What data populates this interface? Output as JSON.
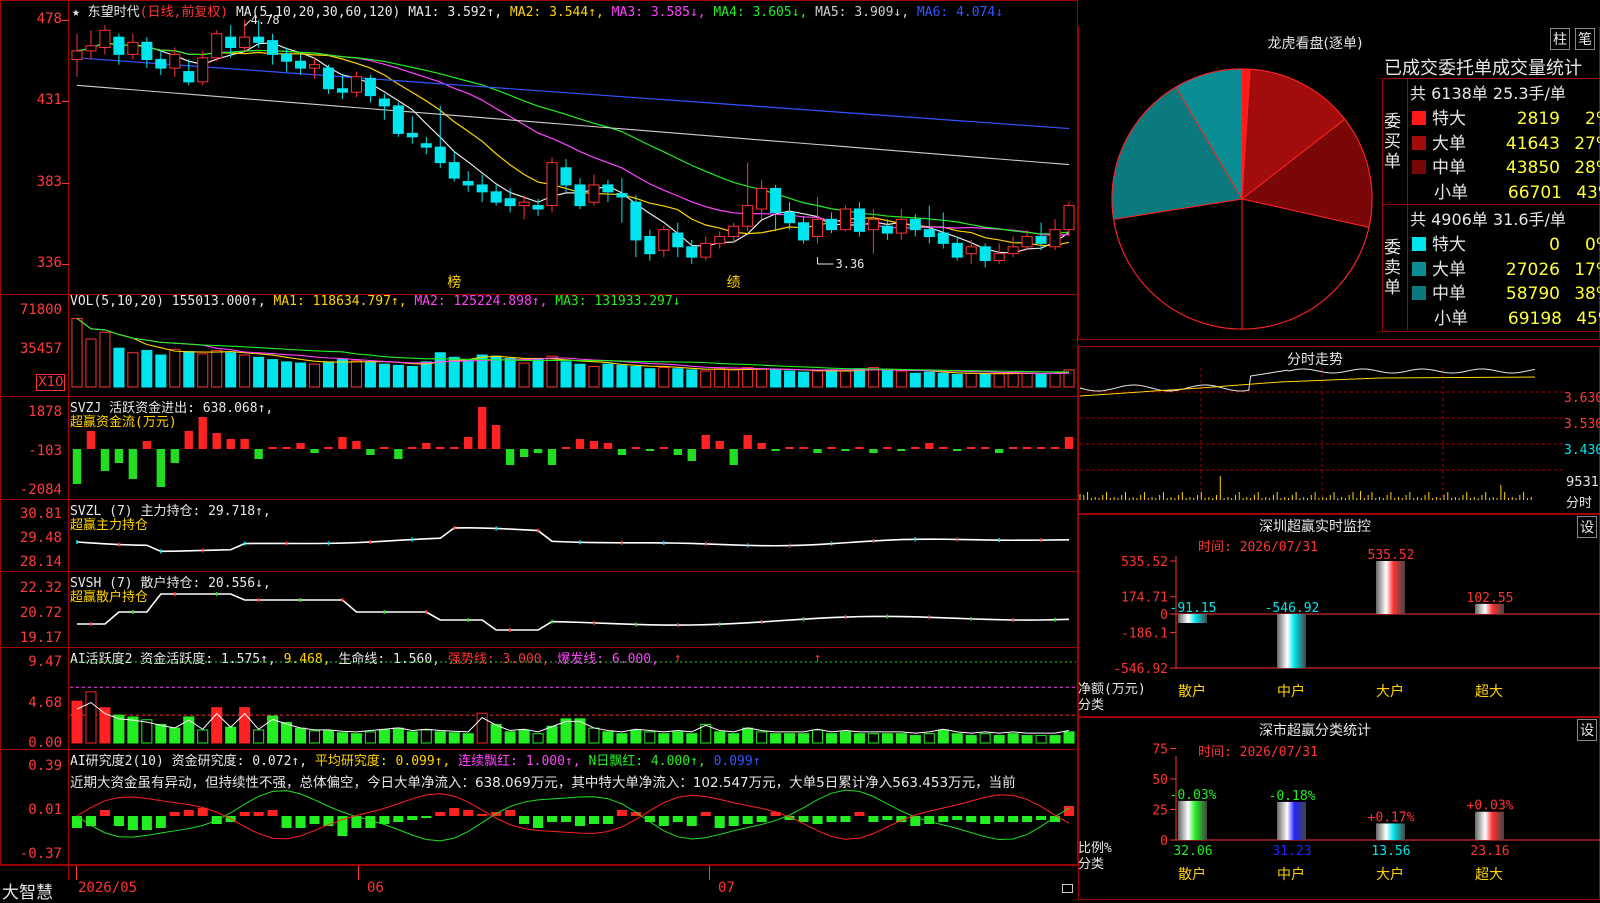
{
  "app": {
    "brand": "大智慧",
    "stock": "东望时代",
    "period_mode": "(日线,前复权)",
    "star": "★"
  },
  "kline": {
    "ma_header": "MA(5,10,20,30,60,120)",
    "ma": [
      {
        "label": "MA1: 3.592↑,",
        "color": "#e8e8e8"
      },
      {
        "label": "MA2: 3.544↑,",
        "color": "#ffd400"
      },
      {
        "label": "MA3: 3.585↓,",
        "color": "#ff44ff"
      },
      {
        "label": "MA4: 3.605↓,",
        "color": "#22ee22"
      },
      {
        "label": "MA5: 3.909↓,",
        "color": "#cfcfcf"
      },
      {
        "label": "MA6: 4.074↓",
        "color": "#3355ff"
      }
    ],
    "yticks": [
      "478",
      "431",
      "383",
      "336"
    ],
    "high_label": "4.78",
    "low_label": "3.36",
    "events": [
      "榜",
      "绩"
    ],
    "candles": [
      [
        4.55,
        4.6,
        4.7,
        4.45
      ],
      [
        4.6,
        4.63,
        4.72,
        4.55
      ],
      [
        4.62,
        4.72,
        4.75,
        4.58
      ],
      [
        4.68,
        4.58,
        4.7,
        4.52
      ],
      [
        4.58,
        4.65,
        4.7,
        4.55
      ],
      [
        4.65,
        4.55,
        4.68,
        4.5
      ],
      [
        4.55,
        4.5,
        4.6,
        4.46
      ],
      [
        4.5,
        4.58,
        4.62,
        4.45
      ],
      [
        4.48,
        4.42,
        4.55,
        4.4
      ],
      [
        4.42,
        4.56,
        4.6,
        4.4
      ],
      [
        4.56,
        4.7,
        4.72,
        4.54
      ],
      [
        4.68,
        4.62,
        4.75,
        4.56
      ],
      [
        4.62,
        4.68,
        4.78,
        4.6
      ],
      [
        4.68,
        4.65,
        4.78,
        4.62
      ],
      [
        4.66,
        4.58,
        4.7,
        4.52
      ],
      [
        4.58,
        4.54,
        4.62,
        4.48
      ],
      [
        4.54,
        4.5,
        4.58,
        4.46
      ],
      [
        4.5,
        4.52,
        4.56,
        4.44
      ],
      [
        4.5,
        4.38,
        4.52,
        4.35
      ],
      [
        4.38,
        4.36,
        4.46,
        4.32
      ],
      [
        4.36,
        4.45,
        4.48,
        4.33
      ],
      [
        4.44,
        4.34,
        4.46,
        4.3
      ],
      [
        4.32,
        4.28,
        4.35,
        4.2
      ],
      [
        4.28,
        4.12,
        4.3,
        4.1
      ],
      [
        4.12,
        4.1,
        4.22,
        4.06
      ],
      [
        4.06,
        4.04,
        4.1,
        4.0
      ],
      [
        4.04,
        3.95,
        4.28,
        3.92
      ],
      [
        3.95,
        3.86,
        4.02,
        3.84
      ],
      [
        3.84,
        3.82,
        3.9,
        3.78
      ],
      [
        3.82,
        3.78,
        3.88,
        3.72
      ],
      [
        3.78,
        3.72,
        3.82,
        3.7
      ],
      [
        3.74,
        3.7,
        3.8,
        3.66
      ],
      [
        3.7,
        3.72,
        3.76,
        3.62
      ],
      [
        3.7,
        3.68,
        3.74,
        3.64
      ],
      [
        3.7,
        3.95,
        3.98,
        3.66
      ],
      [
        3.92,
        3.82,
        3.97,
        3.78
      ],
      [
        3.82,
        3.7,
        3.86,
        3.68
      ],
      [
        3.72,
        3.82,
        3.88,
        3.7
      ],
      [
        3.82,
        3.78,
        3.85,
        3.72
      ],
      [
        3.77,
        3.75,
        3.86,
        3.6
      ],
      [
        3.72,
        3.5,
        3.76,
        3.4
      ],
      [
        3.52,
        3.42,
        3.56,
        3.38
      ],
      [
        3.44,
        3.56,
        3.58,
        3.4
      ],
      [
        3.54,
        3.46,
        3.6,
        3.4
      ],
      [
        3.46,
        3.4,
        3.5,
        3.36
      ],
      [
        3.4,
        3.48,
        3.52,
        3.38
      ],
      [
        3.48,
        3.52,
        3.55,
        3.45
      ],
      [
        3.52,
        3.58,
        3.6,
        3.48
      ],
      [
        3.58,
        3.7,
        3.95,
        3.55
      ],
      [
        3.68,
        3.8,
        3.85,
        3.62
      ],
      [
        3.8,
        3.66,
        3.82,
        3.55
      ],
      [
        3.66,
        3.6,
        3.72,
        3.56
      ],
      [
        3.6,
        3.5,
        3.64,
        3.48
      ],
      [
        3.52,
        3.62,
        3.75,
        3.48
      ],
      [
        3.62,
        3.56,
        3.66,
        3.54
      ],
      [
        3.56,
        3.68,
        3.7,
        3.55
      ],
      [
        3.68,
        3.55,
        3.72,
        3.52
      ],
      [
        3.56,
        3.62,
        3.68,
        3.42
      ],
      [
        3.58,
        3.54,
        3.62,
        3.5
      ],
      [
        3.54,
        3.62,
        3.68,
        3.5
      ],
      [
        3.62,
        3.56,
        3.65,
        3.52
      ],
      [
        3.56,
        3.52,
        3.7,
        3.48
      ],
      [
        3.54,
        3.48,
        3.66,
        3.45
      ],
      [
        3.48,
        3.4,
        3.52,
        3.38
      ],
      [
        3.42,
        3.46,
        3.5,
        3.36
      ],
      [
        3.46,
        3.38,
        3.48,
        3.34
      ],
      [
        3.38,
        3.42,
        3.48,
        3.36
      ],
      [
        3.42,
        3.46,
        3.52,
        3.4
      ],
      [
        3.46,
        3.52,
        3.56,
        3.44
      ],
      [
        3.52,
        3.48,
        3.6,
        3.44
      ],
      [
        3.46,
        3.56,
        3.62,
        3.44
      ],
      [
        3.56,
        3.7,
        3.72,
        3.52
      ]
    ]
  },
  "vol": {
    "header": "VOL(5,10,20)",
    "value": "155013.000↑,",
    "ma1": "MA1: 118634.797↑,",
    "ma2": "MA2: 125224.898↑,",
    "ma3": "MA3: 131933.297↓",
    "yticks": [
      "71800",
      "35457"
    ],
    "unit": "X10"
  },
  "svzj": {
    "header": "SVZJ  活跃资金进出: 638.068↑,",
    "sub": "超赢资金流(万元)",
    "yticks": [
      "1878",
      "-103",
      "-2084"
    ]
  },
  "svzl": {
    "header": "SVZL (7) 主力持仓: 29.718↑,",
    "sub": "超赢主力持仓",
    "yticks": [
      "30.81",
      "29.48",
      "28.14"
    ]
  },
  "svsh": {
    "header": "SVSH (7) 散户持仓: 20.556↓,",
    "sub": "超赢散户持仓",
    "yticks": [
      "22.32",
      "20.72",
      "19.17"
    ]
  },
  "ai1": {
    "header": "AI活跃度2 资金活跃度: 1.575↑,",
    "v2": "9.468,",
    "life": "生命线: 1.560,",
    "strong": "强势线: 3.000,",
    "burst": "爆发线: 6.000,",
    "yticks": [
      "9.47",
      "4.68",
      "0.00"
    ]
  },
  "ai2": {
    "header": "AI研究度2(10) 资金研究度: 0.072↑,",
    "avg": "平均研究度: 0.099↑,",
    "cont": "连续飘红: 1.000↑,",
    "nday": "N日飘红: 4.000↑,",
    "v": "0.099↑",
    "comment": "近期大资金虽有异动，但持续性不强，总体偏空，今日大单净流入：638.069万元，其中特大单净流入：102.547万元，大单5日累计净入563.453万元，当前",
    "yticks": [
      "0.39",
      "0.01",
      "-0.37"
    ]
  },
  "dates": [
    "2026/05",
    "06",
    "07"
  ],
  "lhb": {
    "title": "龙虎看盘(逐单)",
    "btn1": "柱",
    "btn2": "笔",
    "subtitle": "已成交委托单成交量统计",
    "buy_label": "委买单",
    "sell_label": "委卖单",
    "buy_total": "共 6138单 25.3手/单",
    "sell_total": "共 4906单 31.6手/单",
    "buy": [
      {
        "name": "特大",
        "vol": "2819",
        "pct": "2%",
        "color": "#ff1a1a",
        "value": 2
      },
      {
        "name": "大单",
        "vol": "41643",
        "pct": "27%",
        "color": "#a30c0c",
        "value": 27
      },
      {
        "name": "中单",
        "vol": "43850",
        "pct": "28%",
        "color": "#7a0707",
        "value": 28
      },
      {
        "name": "小单",
        "vol": "66701",
        "pct": "43%",
        "color": "#000000",
        "value": 43
      }
    ],
    "sell": [
      {
        "name": "特大",
        "vol": "0",
        "pct": "0%",
        "color": "#00e5ee",
        "value": 0
      },
      {
        "name": "大单",
        "vol": "27026",
        "pct": "17%",
        "color": "#0b8e93",
        "value": 17
      },
      {
        "name": "中单",
        "vol": "58790",
        "pct": "38%",
        "color": "#0a7a7e",
        "value": 38
      },
      {
        "name": "小单",
        "vol": "69198",
        "pct": "45%",
        "color": "#000000",
        "value": 45
      }
    ]
  },
  "intraday": {
    "title": "分时走势",
    "prices": [
      "3.630",
      "3.530",
      "3.430"
    ],
    "vol": "9531",
    "vol_unit": "分时"
  },
  "sz_monitor": {
    "title": "深圳超赢实时监控",
    "btn": "设",
    "time": "时间: 2026/07/31",
    "yticks": [
      "535.52",
      "174.71",
      "0",
      "-186.1",
      "-546.92"
    ],
    "ylab": "净额(万元)",
    "xlab": "分类",
    "bars": [
      {
        "name": "散户",
        "value": -91.15,
        "label": "-91.15",
        "color": "#00e5ee"
      },
      {
        "name": "中户",
        "value": -546.92,
        "label": "-546.92",
        "color": "#00e5ee"
      },
      {
        "name": "大户",
        "value": 535.52,
        "label": "535.52",
        "color": "#ff3333"
      },
      {
        "name": "超大",
        "value": 102.55,
        "label": "102.55",
        "color": "#ff3333"
      }
    ]
  },
  "sz_class": {
    "title": "深市超赢分类统计",
    "btn": "设",
    "time": "时间: 2026/07/31",
    "yticks": [
      "75",
      "50",
      "25",
      "0"
    ],
    "ylab": "比例%",
    "xlab": "分类",
    "bars": [
      {
        "name": "散户",
        "value": 32.06,
        "label": "32.06",
        "chg": "-0.03%",
        "color": "#22ee22"
      },
      {
        "name": "中户",
        "value": 31.23,
        "label": "31.23",
        "chg": "-0.18%",
        "color": "#2222ff"
      },
      {
        "name": "大户",
        "value": 13.56,
        "label": "13.56",
        "chg": "+0.17%",
        "color": "#00e5ee"
      },
      {
        "name": "超大",
        "value": 23.16,
        "label": "23.16",
        "chg": "+0.03%",
        "color": "#ff3333"
      }
    ]
  }
}
